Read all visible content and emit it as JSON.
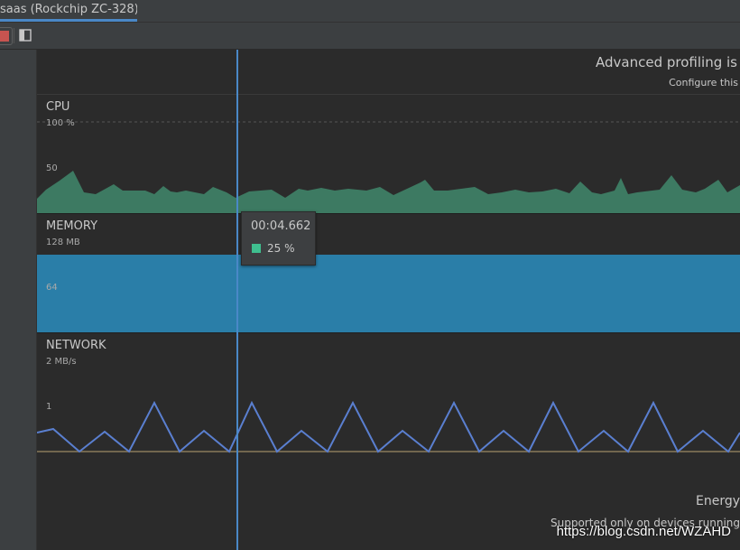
{
  "tab": {
    "title": "saas (Rockchip ZC-328)"
  },
  "banner": {
    "title": "Advanced profiling is",
    "subtitle": "Configure this"
  },
  "monitors": {
    "cpu": {
      "label": "CPU",
      "axis_top": "100 %",
      "axis_mid": "50"
    },
    "memory": {
      "label": "MEMORY",
      "axis_top": "128 MB",
      "axis_mid": "64"
    },
    "network": {
      "label": "NETWORK",
      "axis_top": "2 MB/s",
      "axis_mid": "1"
    }
  },
  "energy": {
    "title": "Energy",
    "subtitle": "Supported only on devices running"
  },
  "tooltip": {
    "time": "00:04.662",
    "value": "25 %"
  },
  "watermark": "https://blog.csdn.net/WZAHD",
  "colors": {
    "cpu_fill": "#3d7a62",
    "memory_fill": "#2a7ea8",
    "network_line": "#5a7fd0",
    "cursor": "#4a88c7",
    "tooltip_swatch": "#3fbf8f"
  }
}
